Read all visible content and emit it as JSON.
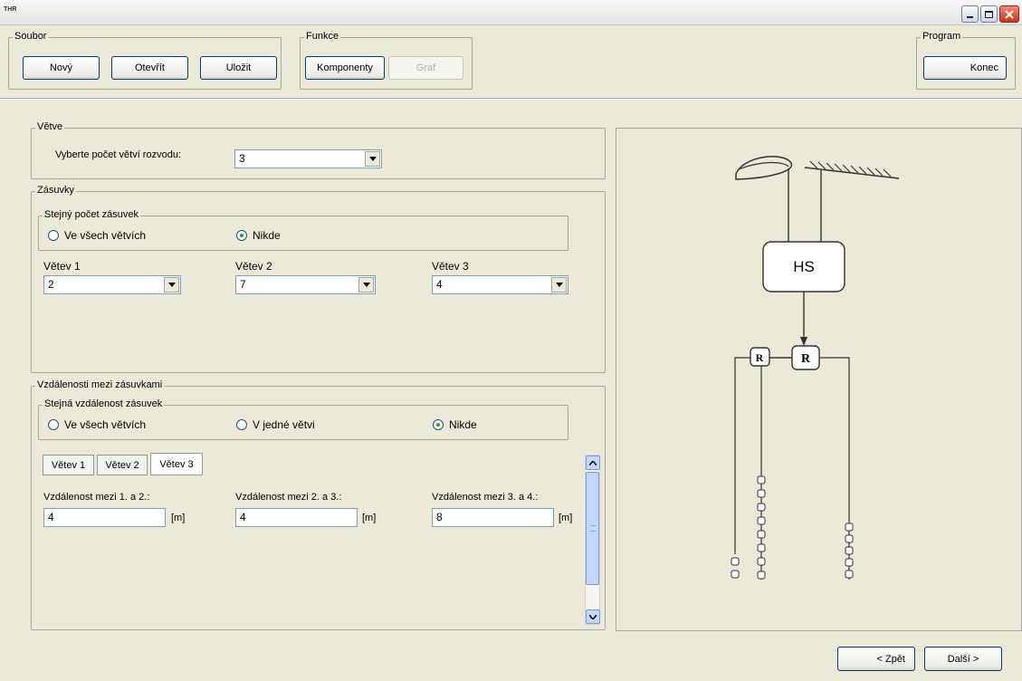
{
  "window": {
    "title": "THR"
  },
  "toolbar": {
    "soubor_label": "Soubor",
    "novy": "Nový",
    "otevrit": "Otevřít",
    "ulozit": "Uložit",
    "funkce_label": "Funkce",
    "komponenty": "Komponenty",
    "graf": "Graf",
    "program_label": "Program",
    "konec": "Konec"
  },
  "vetve": {
    "label": "Větve",
    "prompt": "Vyberte počet větví rozvodu:",
    "value": "3"
  },
  "zasuvky": {
    "label": "Zásuvky",
    "same_label": "Stejný počet zásuvek",
    "option_all": "Ve všech větvích",
    "option_none": "Nikde",
    "selected": "Nikde",
    "branches": [
      {
        "label": "Větev 1",
        "value": "2"
      },
      {
        "label": "Větev 2",
        "value": "7"
      },
      {
        "label": "Větev 3",
        "value": "4"
      }
    ]
  },
  "vzdalenosti": {
    "label": "Vzdálenosti mezi zásuvkami",
    "same_label": "Stejná vzdálenost zásuvek",
    "option_all": "Ve všech větvích",
    "option_one": "V jedné větvi",
    "option_none": "Nikde",
    "selected": "Nikde",
    "tabs": [
      "Větev 1",
      "Větev 2",
      "Větev 3"
    ],
    "active_tab": "Větev 3",
    "fields": [
      {
        "label": "Vzdálenost mezi 1. a 2.:",
        "value": "4",
        "unit": "[m]"
      },
      {
        "label": "Vzdálenost mezi 2. a 3.:",
        "value": "4",
        "unit": "[m]"
      },
      {
        "label": "Vzdálenost mezi 3. a 4.:",
        "value": "8",
        "unit": "[m]"
      }
    ]
  },
  "diagram": {
    "hs_label": "HS",
    "r_label": "R",
    "branch_socket_counts": [
      2,
      7,
      4
    ]
  },
  "nav": {
    "back": "< Zpět",
    "next": "Další >"
  }
}
